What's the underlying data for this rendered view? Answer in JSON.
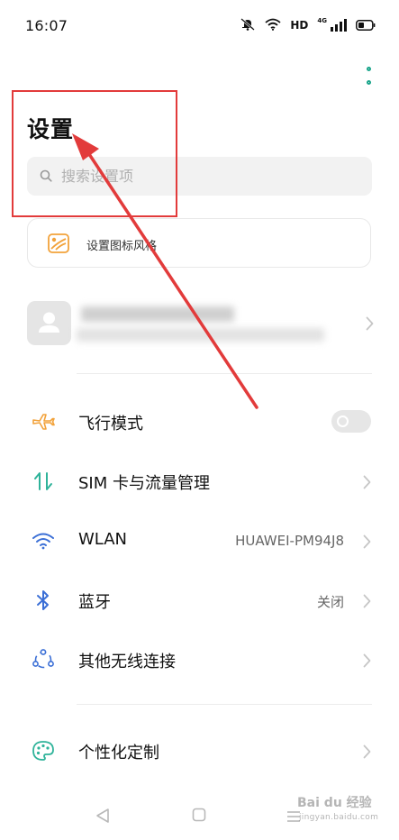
{
  "status_bar": {
    "time": "16:07",
    "hd_label": "HD",
    "network_label": "4G"
  },
  "header": {
    "title": "设置",
    "menu_icon": "more-vertical-icon"
  },
  "search": {
    "placeholder": "搜索设置项",
    "value": ""
  },
  "icon_style_card": {
    "label": "设置图标风格",
    "icon": "icon-style-icon"
  },
  "account": {
    "avatar_icon": "person-icon"
  },
  "settings_items": [
    {
      "label": "飞行模式",
      "icon": "airplane-icon",
      "control": "toggle",
      "enabled": false
    },
    {
      "label": "SIM 卡与流量管理",
      "icon": "sim-data-icon",
      "control": "chevron"
    },
    {
      "label": "WLAN",
      "icon": "wifi-icon",
      "value": "HUAWEI-PM94J8",
      "control": "chevron"
    },
    {
      "label": "蓝牙",
      "icon": "bluetooth-icon",
      "value": "关闭",
      "control": "chevron"
    },
    {
      "label": "其他无线连接",
      "icon": "connections-icon",
      "control": "chevron"
    },
    {
      "label": "个性化定制",
      "icon": "palette-icon",
      "control": "chevron"
    }
  ],
  "nav_bar": {
    "back_icon": "back-triangle-icon",
    "home_icon": "home-square-icon",
    "recents_icon": "menu-lines-icon"
  },
  "watermark": {
    "brand": "Bai du 经验",
    "url": "jingyan.baidu.com"
  },
  "colors": {
    "accent": "#1aa58b",
    "annotation_red": "#e23b3b",
    "icon_orange": "#f2a23a",
    "icon_green": "#2fb39a",
    "icon_blue": "#3b6fd6"
  }
}
